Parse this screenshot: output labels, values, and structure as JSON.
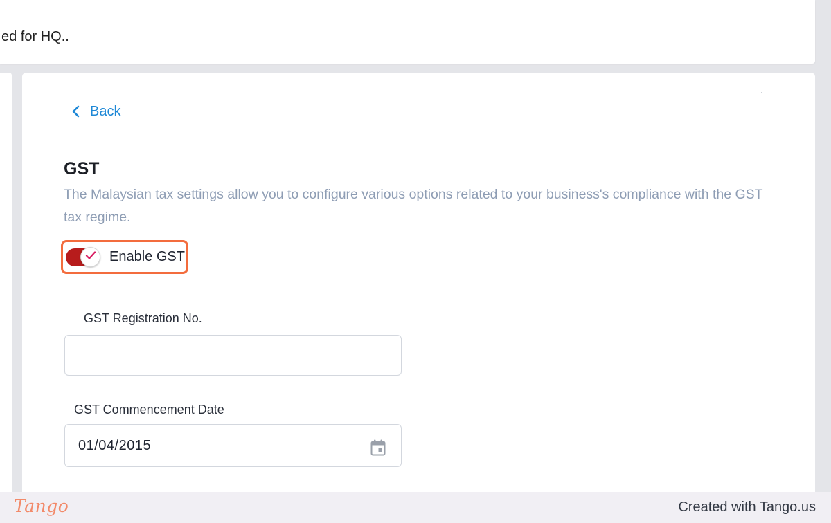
{
  "banner": {
    "text": "ed for HQ.."
  },
  "back": {
    "label": "Back",
    "icon": "chevron-left-icon"
  },
  "section": {
    "title": "GST",
    "description": "The Malaysian tax settings allow you to configure various options related to your business's compliance with the GST tax regime."
  },
  "toggle": {
    "label": "Enable GST",
    "checked": true,
    "icon": "check-icon"
  },
  "fields": {
    "registration": {
      "label": "GST Registration No.",
      "value": ""
    },
    "commencement": {
      "label": "GST Commencement Date",
      "value": "01/04/2015",
      "icon": "calendar-icon"
    }
  },
  "footer": {
    "logo": "Tango",
    "credit": "Created with Tango.us"
  },
  "colors": {
    "accent_blue": "#1e88d6",
    "toggle_on": "#b71c1c",
    "highlight": "#f36c3d",
    "description": "#8e9db4",
    "logo": "#f28a6a"
  }
}
